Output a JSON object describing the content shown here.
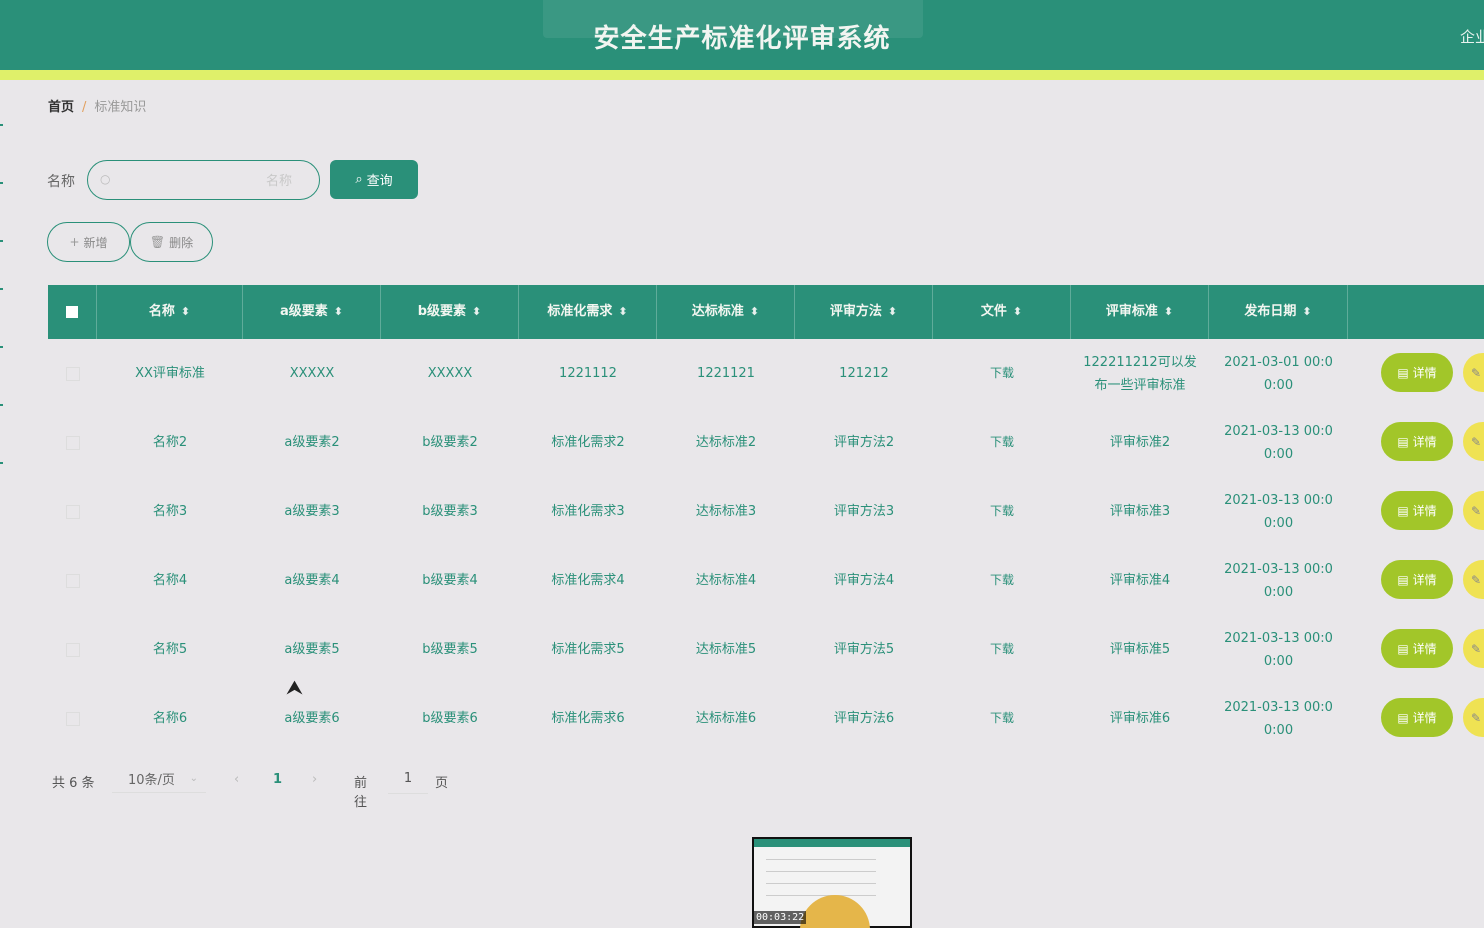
{
  "app": {
    "title": "安全生产标准化评审系统",
    "top_right_text": "企业"
  },
  "breadcrumb": {
    "home": "首页",
    "separator": "/",
    "current": "标准知识"
  },
  "search": {
    "label": "名称",
    "placeholder": "名称",
    "value": "",
    "button_label": "查询"
  },
  "actions": {
    "add_label": "新增",
    "delete_label": "删除"
  },
  "colors": {
    "primary": "#2a9079",
    "accent_bar": "#dff06a",
    "detail_button": "#a2c629",
    "edit_button": "#efe253",
    "background": "#e9e7ea"
  },
  "icons": {
    "search": "search-icon",
    "add": "plus-icon",
    "delete": "trash-icon",
    "detail": "document-icon",
    "edit": "edit-icon",
    "sort": "sort-icon"
  },
  "table": {
    "headers": [
      "名称",
      "a级要素",
      "b级要素",
      "标准化需求",
      "达标标准",
      "评审方法",
      "文件",
      "评审标准",
      "发布日期",
      ""
    ],
    "rows": [
      {
        "name": "XX评审标准",
        "a": "XXXXX",
        "b": "XXXXX",
        "need": "1221112",
        "reach": "1221121",
        "method": "121212",
        "file": "下载",
        "review": "122211212可以发布一些评审标准",
        "date": "2021-03-01 00:00:00",
        "detail": "详情"
      },
      {
        "name": "名称2",
        "a": "a级要素2",
        "b": "b级要素2",
        "need": "标准化需求2",
        "reach": "达标标准2",
        "method": "评审方法2",
        "file": "下载",
        "review": "评审标准2",
        "date": "2021-03-13 00:00:00",
        "detail": "详情"
      },
      {
        "name": "名称3",
        "a": "a级要素3",
        "b": "b级要素3",
        "need": "标准化需求3",
        "reach": "达标标准3",
        "method": "评审方法3",
        "file": "下载",
        "review": "评审标准3",
        "date": "2021-03-13 00:00:00",
        "detail": "详情"
      },
      {
        "name": "名称4",
        "a": "a级要素4",
        "b": "b级要素4",
        "need": "标准化需求4",
        "reach": "达标标准4",
        "method": "评审方法4",
        "file": "下载",
        "review": "评审标准4",
        "date": "2021-03-13 00:00:00",
        "detail": "详情"
      },
      {
        "name": "名称5",
        "a": "a级要素5",
        "b": "b级要素5",
        "need": "标准化需求5",
        "reach": "达标标准5",
        "method": "评审方法5",
        "file": "下载",
        "review": "评审标准5",
        "date": "2021-03-13 00:00:00",
        "detail": "详情"
      },
      {
        "name": "名称6",
        "a": "a级要素6",
        "b": "b级要素6",
        "need": "标准化需求6",
        "reach": "达标标准6",
        "method": "评审方法6",
        "file": "下载",
        "review": "评审标准6",
        "date": "2021-03-13 00:00:00",
        "detail": "详情"
      }
    ]
  },
  "pagination": {
    "total_text": "共 6 条",
    "page_size": "10条/页",
    "current_page": "1",
    "goto_label": "前往",
    "goto_value": "1",
    "page_word": "页"
  },
  "video_thumbnail": {
    "timestamp": "00:03:22"
  }
}
